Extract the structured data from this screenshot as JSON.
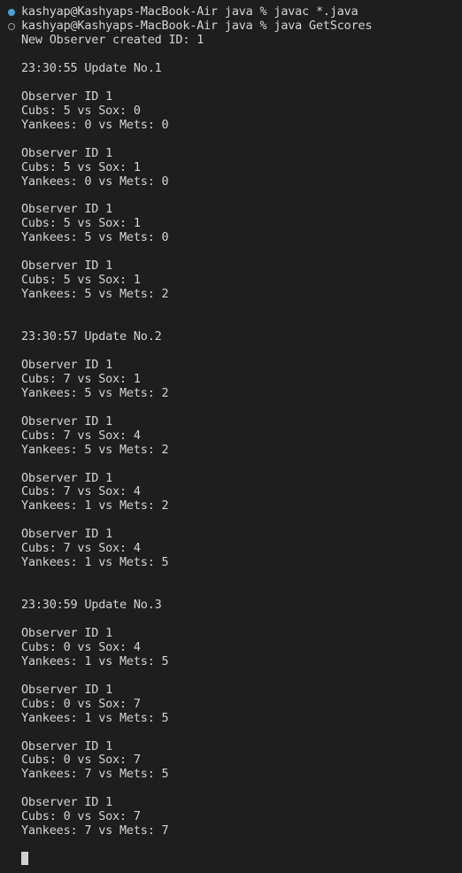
{
  "terminal": {
    "prompts": [
      {
        "marker": "success",
        "text": "kashyap@Kashyaps-MacBook-Air java % javac *.java"
      },
      {
        "marker": "running",
        "text": "kashyap@Kashyaps-MacBook-Air java % java GetScores"
      }
    ],
    "output": [
      "New Observer created ID: 1",
      "",
      "23:30:55 Update No.1",
      "",
      "Observer ID 1",
      "Cubs: 5 vs Sox: 0",
      "Yankees: 0 vs Mets: 0",
      "",
      "Observer ID 1",
      "Cubs: 5 vs Sox: 1",
      "Yankees: 0 vs Mets: 0",
      "",
      "Observer ID 1",
      "Cubs: 5 vs Sox: 1",
      "Yankees: 5 vs Mets: 0",
      "",
      "Observer ID 1",
      "Cubs: 5 vs Sox: 1",
      "Yankees: 5 vs Mets: 2",
      "",
      "",
      "23:30:57 Update No.2",
      "",
      "Observer ID 1",
      "Cubs: 7 vs Sox: 1",
      "Yankees: 5 vs Mets: 2",
      "",
      "Observer ID 1",
      "Cubs: 7 vs Sox: 4",
      "Yankees: 5 vs Mets: 2",
      "",
      "Observer ID 1",
      "Cubs: 7 vs Sox: 4",
      "Yankees: 1 vs Mets: 2",
      "",
      "Observer ID 1",
      "Cubs: 7 vs Sox: 4",
      "Yankees: 1 vs Mets: 5",
      "",
      "",
      "23:30:59 Update No.3",
      "",
      "Observer ID 1",
      "Cubs: 0 vs Sox: 4",
      "Yankees: 1 vs Mets: 5",
      "",
      "Observer ID 1",
      "Cubs: 0 vs Sox: 7",
      "Yankees: 1 vs Mets: 5",
      "",
      "Observer ID 1",
      "Cubs: 0 vs Sox: 7",
      "Yankees: 7 vs Mets: 5",
      "",
      "Observer ID 1",
      "Cubs: 0 vs Sox: 7",
      "Yankees: 7 vs Mets: 7"
    ]
  },
  "colors": {
    "background": "#1e1e1e",
    "text": "#d4d4d4",
    "marker_success": "#4aa0d9",
    "marker_running": "#9a9a9a",
    "cursor": "#cfcfcf"
  }
}
